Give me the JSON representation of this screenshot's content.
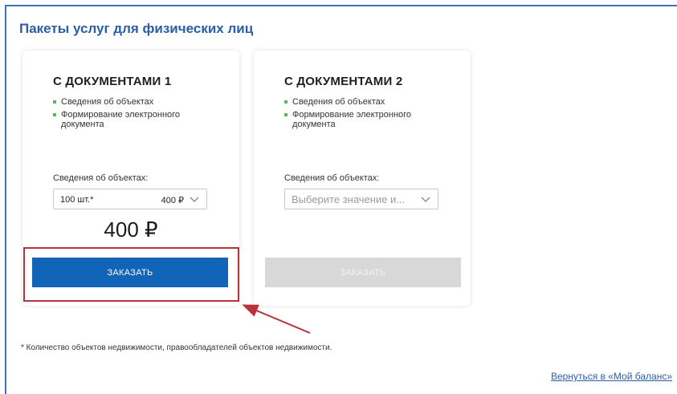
{
  "page": {
    "title": "Пакеты услуг для физических лиц",
    "footnote": "* Количество объектов недвижимости, правообладателей объектов недвижимости.",
    "back_link": "Вернуться в «Мой баланс»"
  },
  "colors": {
    "title": "#2a5ea6",
    "primary_button": "#1264b8",
    "disabled_button": "#d8d8d8",
    "bullet": "#5cb85c",
    "annotation": "#b7323a"
  },
  "cards": [
    {
      "title": "С ДОКУМЕНТАМИ 1",
      "features": [
        "Сведения об объектах",
        "Формирование электронного документа"
      ],
      "field_label": "Сведения об объектах:",
      "select_value": "100 шт.*",
      "select_price": "400 ₽",
      "price": "400 ₽",
      "button_label": "ЗАКАЗАТЬ"
    },
    {
      "title": "С ДОКУМЕНТАМИ 2",
      "features": [
        "Сведения об объектах",
        "Формирование электронного документа"
      ],
      "field_label": "Сведения об объектах:",
      "select_placeholder": "Выберите значение и...",
      "button_label": "ЗАКАЗАТЬ"
    }
  ]
}
